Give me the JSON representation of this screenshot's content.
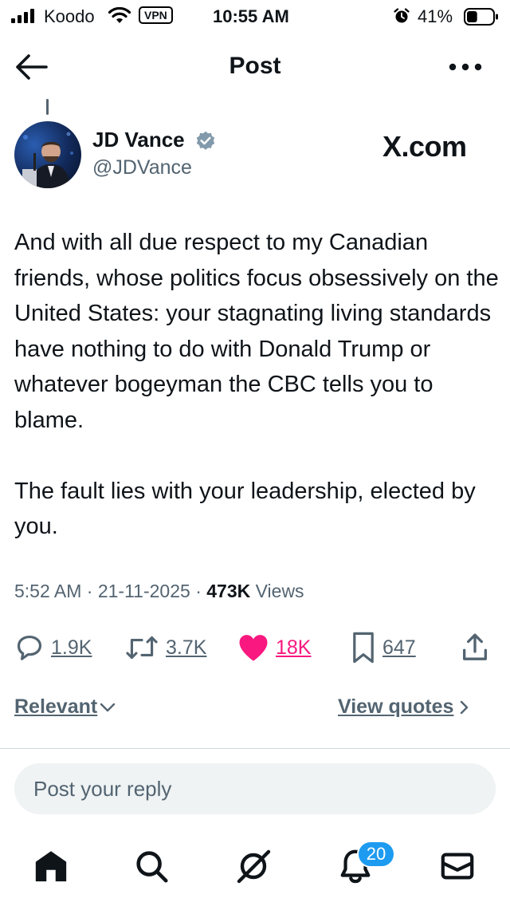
{
  "status_bar": {
    "carrier": "Koodo",
    "vpn_label": "VPN",
    "time": "10:55 AM",
    "battery_percent": "41%",
    "battery_level": 0.41
  },
  "header": {
    "title": "Post"
  },
  "post": {
    "author_name": "JD Vance",
    "author_handle": "@JDVance",
    "watermark": "X.com",
    "text": "And with all due respect to my Canadian friends, whose politics focus obsessively on the United States: your stagnating living standards have nothing to do with Donald Trump or whatever bogeyman the CBC tells you to blame.\n\nThe fault lies with your leadership, elected by you.",
    "time": "5:52 AM",
    "date": "21-11-2025",
    "views_count": "473K",
    "views_label": "Views",
    "separator": "·"
  },
  "actions": {
    "replies": "1.9K",
    "reposts": "3.7K",
    "likes": "18K",
    "bookmarks": "647"
  },
  "filters": {
    "sort_label": "Relevant",
    "quotes_label": "View quotes"
  },
  "reply": {
    "placeholder": "Post your reply"
  },
  "nav": {
    "notifications_badge": "20"
  },
  "colors": {
    "like_pink": "#f91880",
    "verified_blue": "#829aab",
    "badge_blue": "#1d9bf0",
    "secondary_text": "#536471"
  }
}
